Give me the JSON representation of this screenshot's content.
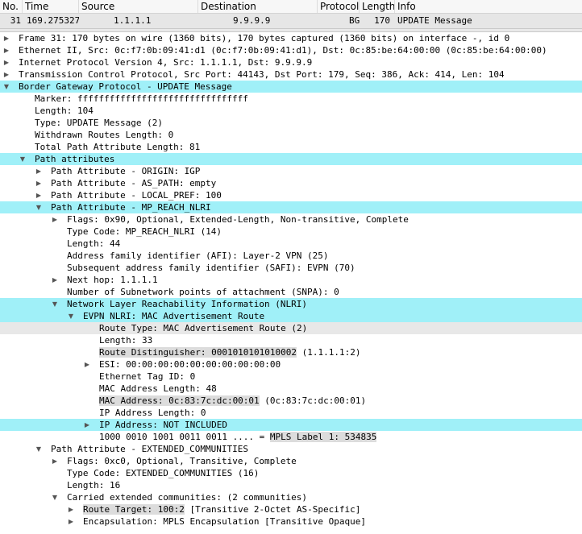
{
  "columns": [
    {
      "label": "No."
    },
    {
      "label": "Time"
    },
    {
      "label": "Source"
    },
    {
      "label": "Destination"
    },
    {
      "label": "Protocol"
    },
    {
      "label": "Length"
    },
    {
      "label": "Info"
    }
  ],
  "packet": {
    "no": "31",
    "time": "169.275327",
    "source": "1.1.1.1",
    "destination": "9.9.9.9",
    "protocol": "BGP",
    "length": "170",
    "info": "UPDATE Message"
  },
  "tree": [
    {
      "text": "Frame 31: 170 bytes on wire (1360 bits), 170 bytes captured (1360 bits) on interface -, id 0",
      "level": 0,
      "arrow": "collapsed"
    },
    {
      "text": "Ethernet II, Src: 0c:f7:0b:09:41:d1 (0c:f7:0b:09:41:d1), Dst: 0c:85:be:64:00:00 (0c:85:be:64:00:00)",
      "level": 0,
      "arrow": "collapsed"
    },
    {
      "text": "Internet Protocol Version 4, Src: 1.1.1.1, Dst: 9.9.9.9",
      "level": 0,
      "arrow": "collapsed"
    },
    {
      "text": "Transmission Control Protocol, Src Port: 44143, Dst Port: 179, Seq: 386, Ack: 414, Len: 104",
      "level": 0,
      "arrow": "collapsed"
    },
    {
      "text": "Border Gateway Protocol - UPDATE Message",
      "level": 0,
      "arrow": "expanded",
      "highlight": "cyan"
    },
    {
      "text": "Marker: ffffffffffffffffffffffffffffffff",
      "level": 1
    },
    {
      "text": "Length: 104",
      "level": 1
    },
    {
      "text": "Type: UPDATE Message (2)",
      "level": 1
    },
    {
      "text": "Withdrawn Routes Length: 0",
      "level": 1
    },
    {
      "text": "Total Path Attribute Length: 81",
      "level": 1
    },
    {
      "text": "Path attributes",
      "level": 1,
      "arrow": "expanded",
      "highlight": "cyan"
    },
    {
      "text": "Path Attribute - ORIGIN: IGP",
      "level": 2,
      "arrow": "collapsed"
    },
    {
      "text": "Path Attribute - AS_PATH: empty",
      "level": 2,
      "arrow": "collapsed"
    },
    {
      "text": "Path Attribute - LOCAL_PREF: 100",
      "level": 2,
      "arrow": "collapsed"
    },
    {
      "text": "Path Attribute - MP_REACH_NLRI",
      "level": 2,
      "arrow": "expanded",
      "highlight": "cyan"
    },
    {
      "text": "Flags: 0x90, Optional, Extended-Length, Non-transitive, Complete",
      "level": 3,
      "arrow": "collapsed"
    },
    {
      "text": "Type Code: MP_REACH_NLRI (14)",
      "level": 3
    },
    {
      "text": "Length: 44",
      "level": 3
    },
    {
      "text": "Address family identifier (AFI): Layer-2 VPN (25)",
      "level": 3
    },
    {
      "text": "Subsequent address family identifier (SAFI): EVPN (70)",
      "level": 3
    },
    {
      "text": "Next hop: 1.1.1.1",
      "level": 3,
      "arrow": "collapsed"
    },
    {
      "text": "Number of Subnetwork points of attachment (SNPA): 0",
      "level": 3
    },
    {
      "text": "Network Layer Reachability Information (NLRI)",
      "level": 3,
      "arrow": "expanded",
      "highlight": "cyan"
    },
    {
      "text": "EVPN NLRI: MAC Advertisement Route",
      "level": 4,
      "arrow": "expanded",
      "highlight": "cyan"
    },
    {
      "text": "Route Type: MAC Advertisement Route (2)",
      "level": 5,
      "highlight": "gray"
    },
    {
      "text": "Length: 33",
      "level": 5
    },
    {
      "box": "Route Distinguisher: 0001010101010002",
      "rest": " (1.1.1.1:2)",
      "level": 5
    },
    {
      "text": "ESI: 00:00:00:00:00:00:00:00:00:00",
      "level": 5,
      "arrow": "collapsed"
    },
    {
      "text": "Ethernet Tag ID: 0",
      "level": 5
    },
    {
      "text": "MAC Address Length: 48",
      "level": 5
    },
    {
      "box": "MAC Address: 0c:83:7c:dc:00:01",
      "rest": " (0c:83:7c:dc:00:01)",
      "level": 5
    },
    {
      "text": "IP Address Length: 0",
      "level": 5
    },
    {
      "text": "IP Address: NOT INCLUDED",
      "level": 5,
      "arrow": "collapsed",
      "highlight": "cyan"
    },
    {
      "pre": "1000 0010 1001 0011 0011 .... = ",
      "box": "MPLS Label 1: 534835",
      "level": 5
    },
    {
      "text": "Path Attribute - EXTENDED_COMMUNITIES",
      "level": 2,
      "arrow": "expanded"
    },
    {
      "text": "Flags: 0xc0, Optional, Transitive, Complete",
      "level": 3,
      "arrow": "collapsed"
    },
    {
      "text": "Type Code: EXTENDED_COMMUNITIES (16)",
      "level": 3
    },
    {
      "text": "Length: 16",
      "level": 3
    },
    {
      "text": "Carried extended communities: (2 communities)",
      "level": 3,
      "arrow": "expanded"
    },
    {
      "box": "Route Target: 100:2",
      "rest": " [Transitive 2-Octet AS-Specific]",
      "level": 4,
      "arrow": "collapsed"
    },
    {
      "text": "Encapsulation: MPLS Encapsulation [Transitive Opaque]",
      "level": 4,
      "arrow": "collapsed"
    }
  ]
}
